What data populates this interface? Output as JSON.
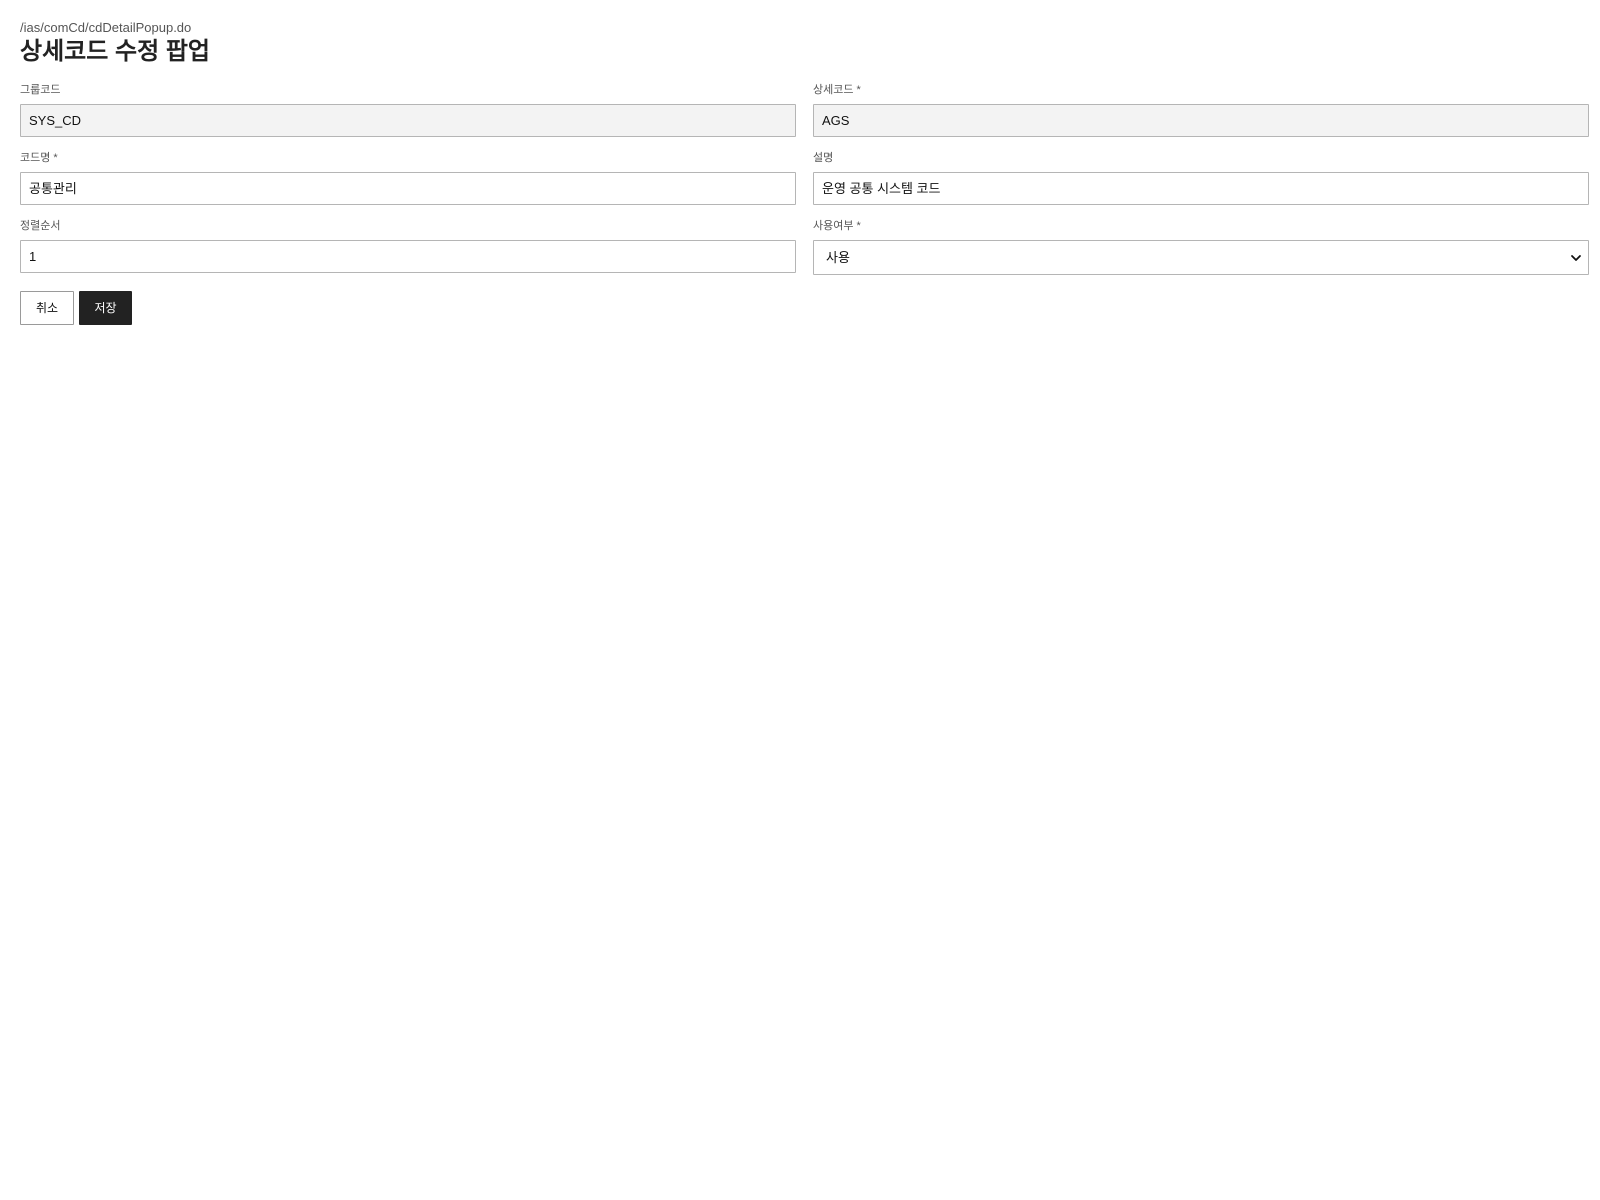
{
  "page": {
    "url_path": "/ias/comCd/cdDetailPopup.do",
    "title": "상세코드 수정 팝업"
  },
  "form": {
    "group_code": {
      "label": "그룹코드",
      "value": "SYS_CD"
    },
    "detail_code": {
      "label": "상세코드 *",
      "value": "AGS"
    },
    "code_name": {
      "label": "코드명 *",
      "value": "공통관리"
    },
    "description": {
      "label": "설명",
      "value": "운영 공통 시스템 코드"
    },
    "sort_order": {
      "label": "정렬순서",
      "value": "1"
    },
    "use_yn": {
      "label": "사용여부 *",
      "selected": "사용"
    }
  },
  "actions": {
    "cancel_label": "취소",
    "save_label": "저장"
  },
  "icons": {
    "select_chevron": "chevron-down-icon"
  },
  "colors": {
    "primary_button": "#222222",
    "readonly_field_bg": "#f3f3f3",
    "border": "#b5b5b5"
  }
}
